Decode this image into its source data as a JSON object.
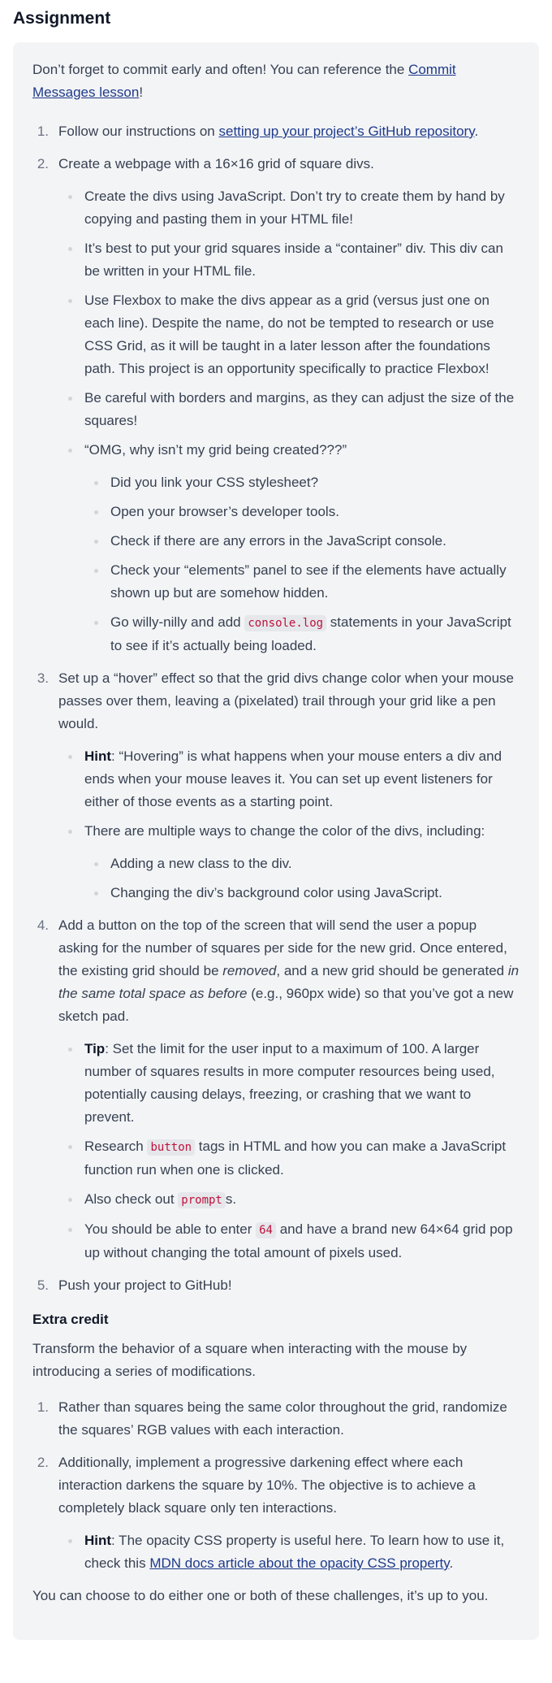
{
  "heading": "Assignment",
  "intro": {
    "text_before": "Don’t forget to commit early and often! You can reference the ",
    "link": "Commit Messages lesson",
    "text_after": "!"
  },
  "steps": {
    "s1": {
      "num": "1.",
      "before": "Follow our instructions on ",
      "link": "setting up your project’s GitHub repository",
      "after": "."
    },
    "s2": {
      "num": "2.",
      "text": "Create a webpage with a 16×16 grid of square divs.",
      "b1": "Create the divs using JavaScript. Don’t try to create them by hand by copying and pasting them in your HTML file!",
      "b2": "It’s best to put your grid squares inside a “container” div. This div can be written in your HTML file.",
      "b3": "Use Flexbox to make the divs appear as a grid (versus just one on each line). Despite the name, do not be tempted to research or use CSS Grid, as it will be taught in a later lesson after the foundations path. This project is an opportunity specifically to practice Flexbox!",
      "b4": "Be careful with borders and margins, as they can adjust the size of the squares!",
      "b5": "“OMG, why isn’t my grid being created???”",
      "c1": "Did you link your CSS stylesheet?",
      "c2": "Open your browser’s developer tools.",
      "c3": "Check if there are any errors in the JavaScript console.",
      "c4": "Check your “elements” panel to see if the elements have actually shown up but are somehow hidden.",
      "c5_before": "Go willy-nilly and add ",
      "c5_code": "console.log",
      "c5_after": " statements in your JavaScript to see if it’s actually being loaded."
    },
    "s3": {
      "num": "3.",
      "text": "Set up a “hover” effect so that the grid divs change color when your mouse passes over them, leaving a (pixelated) trail through your grid like a pen would.",
      "hint_label": "Hint",
      "hint_text": ": “Hovering” is what happens when your mouse enters a div and ends when your mouse leaves it. You can set up event listeners for either of those events as a starting point.",
      "b2": "There are multiple ways to change the color of the divs, including:",
      "c1": "Adding a new class to the div.",
      "c2": "Changing the div’s background color using JavaScript."
    },
    "s4": {
      "num": "4.",
      "t1": "Add a button on the top of the screen that will send the user a popup asking for the number of squares per side for the new grid. Once entered, the existing grid should be ",
      "em1": "removed",
      "t2": ", and a new grid should be generated ",
      "em2": "in the same total space as before",
      "t3": " (e.g., 960px wide) so that you’ve got a new sketch pad.",
      "tip_label": "Tip",
      "tip_text": ": Set the limit for the user input to a maximum of 100. A larger number of squares results in more computer resources being used, potentially causing delays, freezing, or crashing that we want to prevent.",
      "b2_before": "Research ",
      "b2_code": "button",
      "b2_after": " tags in HTML and how you can make a JavaScript function run when one is clicked.",
      "b3_before": "Also check out ",
      "b3_code": "prompt",
      "b3_after": "s.",
      "b4_before": "You should be able to enter ",
      "b4_code": "64",
      "b4_after": " and have a brand new 64×64 grid pop up without changing the total amount of pixels used."
    },
    "s5": {
      "num": "5.",
      "text": "Push your project to GitHub!"
    }
  },
  "extra": {
    "heading": "Extra credit",
    "intro": "Transform the behavior of a square when interacting with the mouse by introducing a series of modifications.",
    "e1": {
      "num": "1.",
      "text": "Rather than squares being the same color throughout the grid, randomize the squares’ RGB values with each interaction."
    },
    "e2": {
      "num": "2.",
      "text": "Additionally, implement a progressive darkening effect where each interaction darkens the square by 10%. The objective is to achieve a completely black square only ten interactions.",
      "hint_label": "Hint",
      "hint_before": ": The opacity CSS property is useful here. To learn how to use it, check this ",
      "hint_link": "MDN docs article about the opacity CSS property",
      "hint_after": "."
    },
    "outro": "You can choose to do either one or both of these challenges, it’s up to you."
  }
}
